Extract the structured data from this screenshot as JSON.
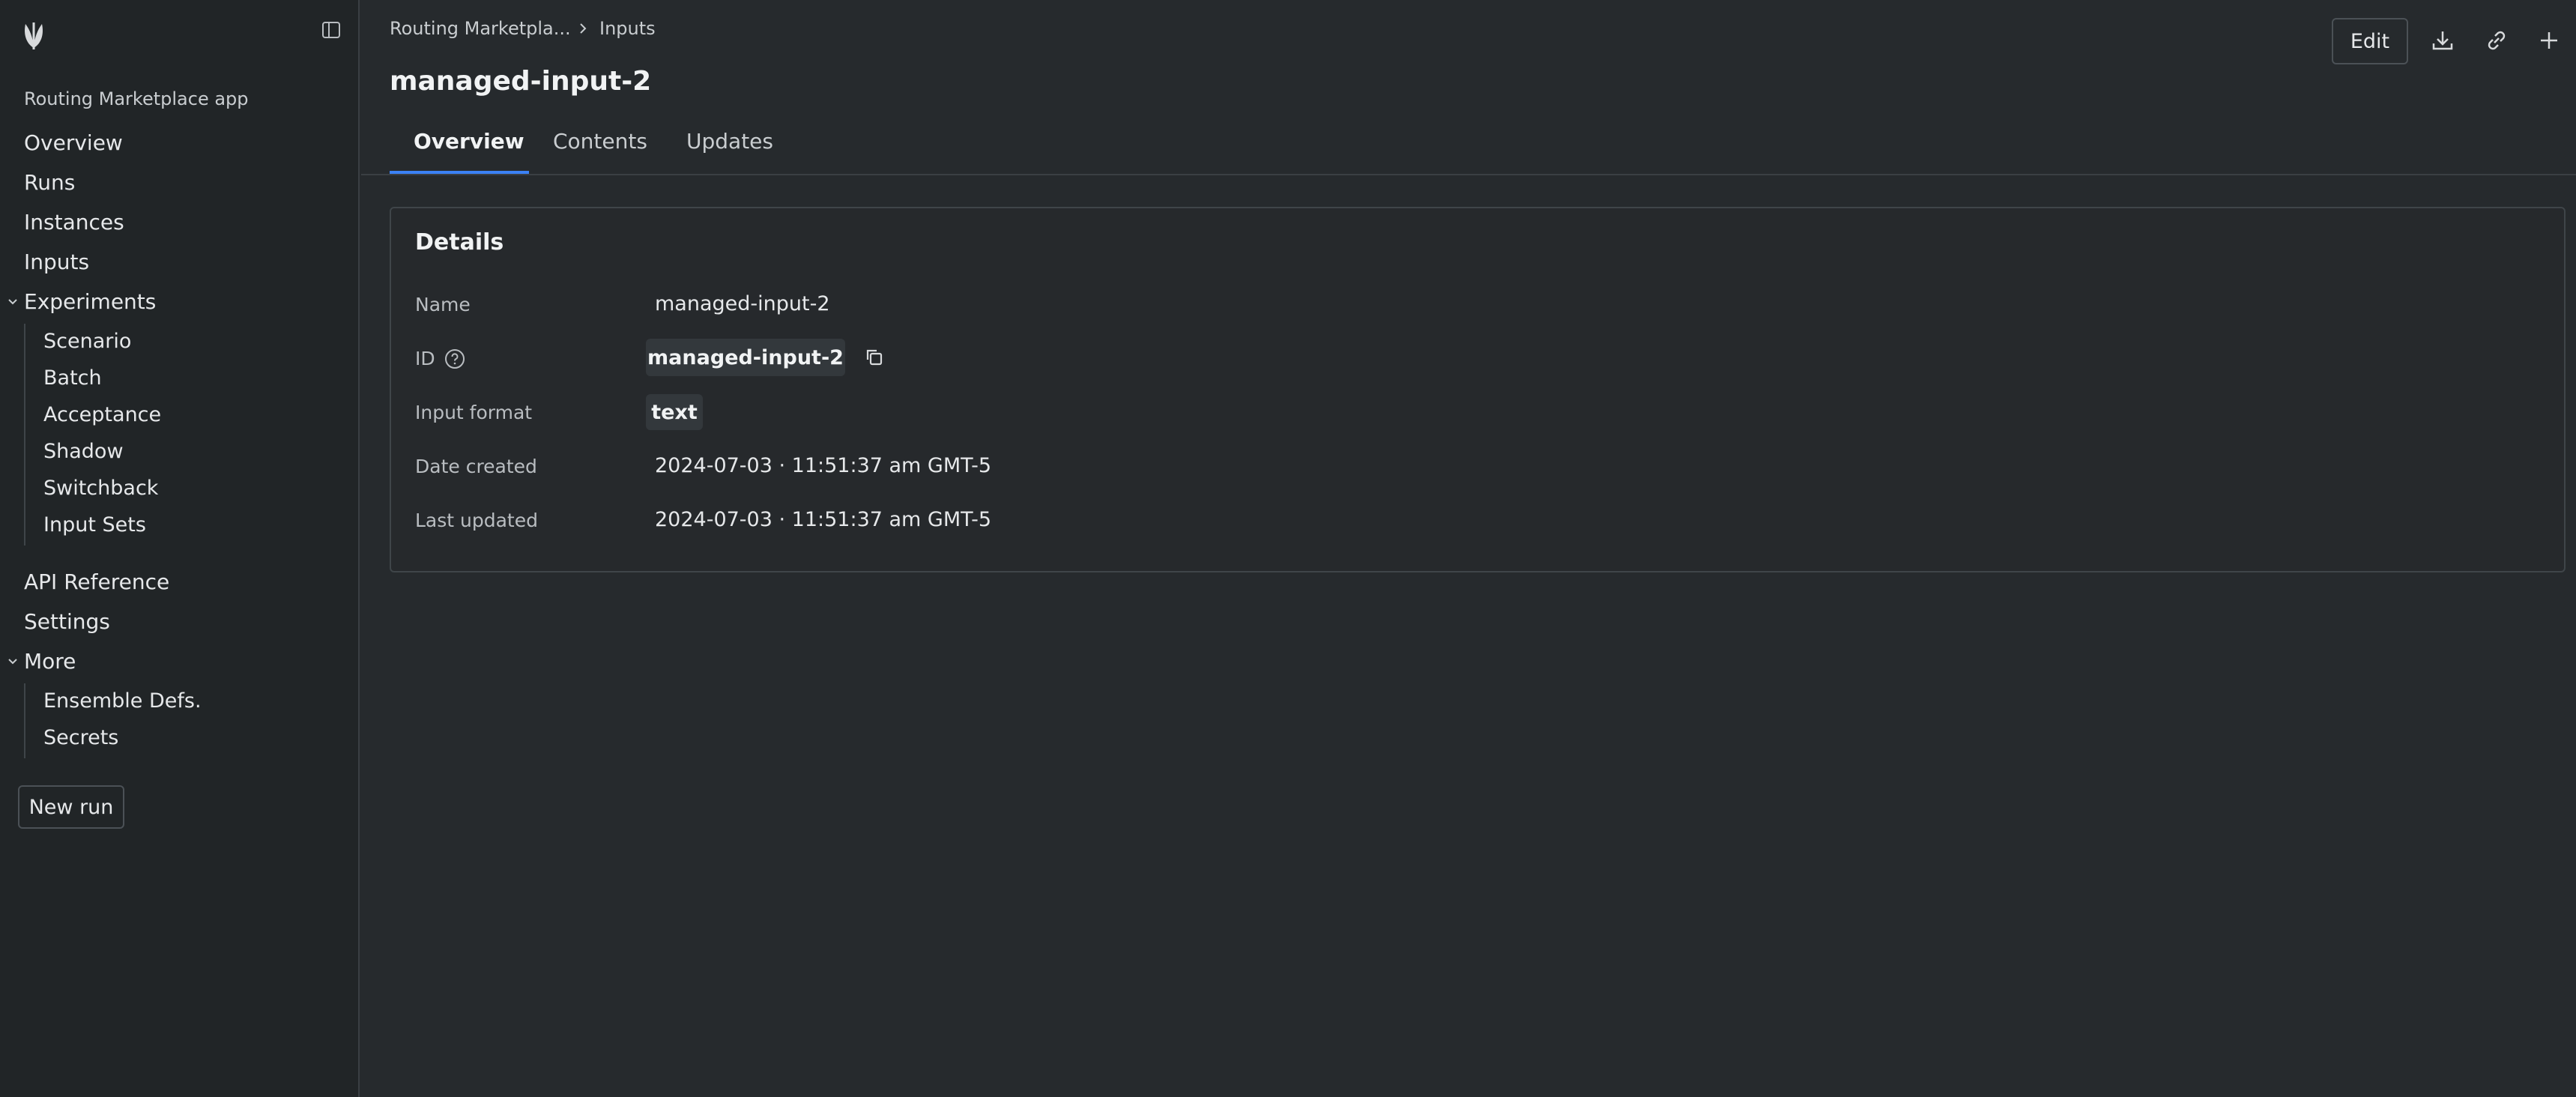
{
  "sidebar": {
    "app_name": "Routing Marketplace app",
    "items": {
      "overview": "Overview",
      "runs": "Runs",
      "instances": "Instances",
      "inputs": "Inputs",
      "experiments": "Experiments",
      "scenario": "Scenario",
      "batch": "Batch",
      "acceptance": "Acceptance",
      "shadow": "Shadow",
      "switchback": "Switchback",
      "input_sets": "Input Sets",
      "api_reference": "API Reference",
      "settings": "Settings",
      "more": "More",
      "ensemble_defs": "Ensemble Defs.",
      "secrets": "Secrets"
    },
    "new_run_label": "New run"
  },
  "breadcrumb": {
    "parent": "Routing Marketpla...",
    "current": "Inputs"
  },
  "page": {
    "title": "managed-input-2"
  },
  "toolbar": {
    "edit_label": "Edit"
  },
  "tabs": {
    "overview": "Overview",
    "contents": "Contents",
    "updates": "Updates",
    "active": "overview"
  },
  "details": {
    "title": "Details",
    "name_label": "Name",
    "name_value": "managed-input-2",
    "id_label": "ID",
    "id_value": "managed-input-2",
    "input_format_label": "Input format",
    "input_format_value": "text",
    "date_created_label": "Date created",
    "date_created_value": "2024-07-03 · 11:51:37 am GMT-5",
    "last_updated_label": "Last updated",
    "last_updated_value": "2024-07-03 · 11:51:37 am GMT-5"
  },
  "colors": {
    "background": "#262a2d",
    "sidebar": "#212527",
    "accent": "#3b82f6"
  }
}
